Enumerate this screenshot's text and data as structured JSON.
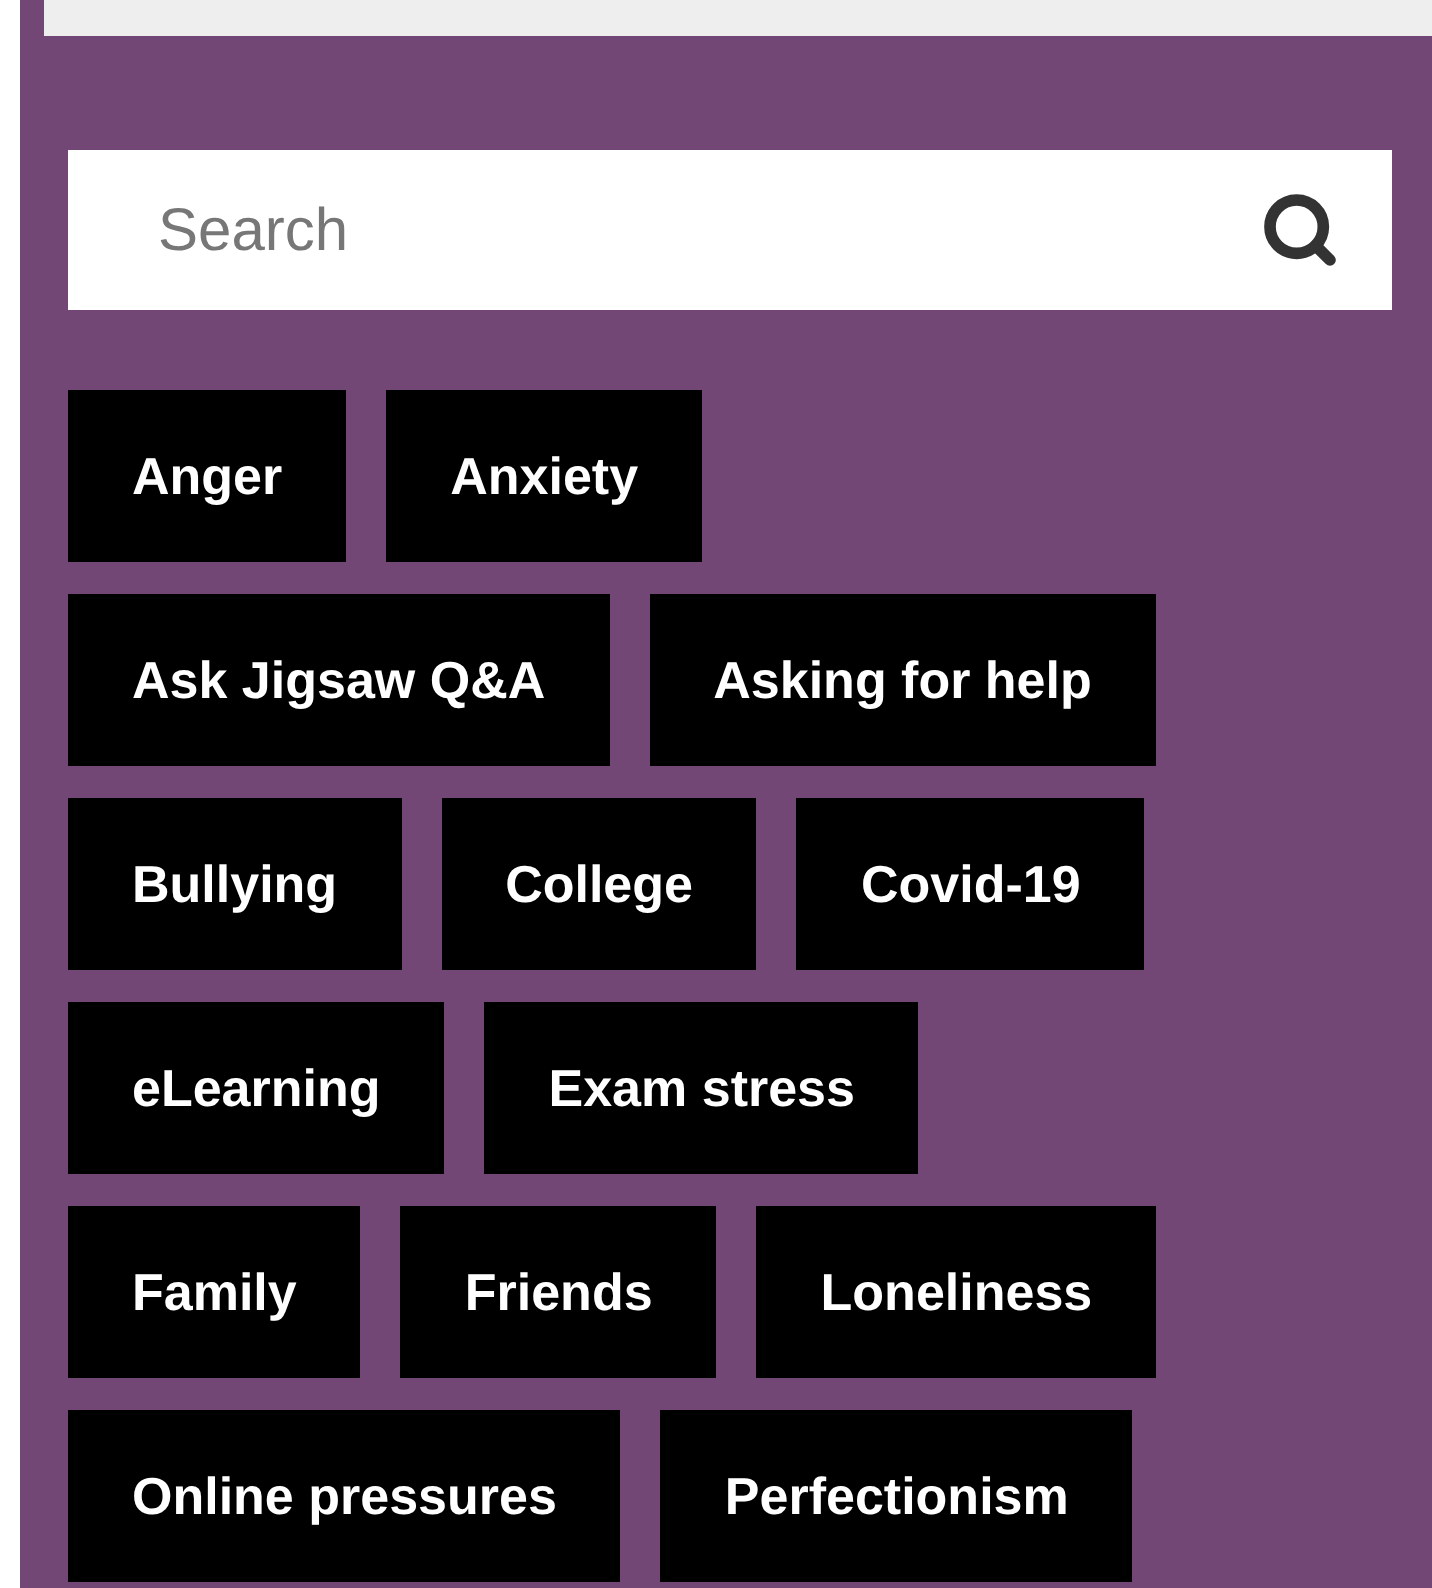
{
  "search": {
    "placeholder": "Search"
  },
  "tags": [
    "Anger",
    "Anxiety",
    "Ask Jigsaw Q&A",
    "Asking for help",
    "Bullying",
    "College",
    "Covid-19",
    "eLearning",
    "Exam stress",
    "Family",
    "Friends",
    "Loneliness",
    "Online pressures",
    "Perfectionism"
  ]
}
